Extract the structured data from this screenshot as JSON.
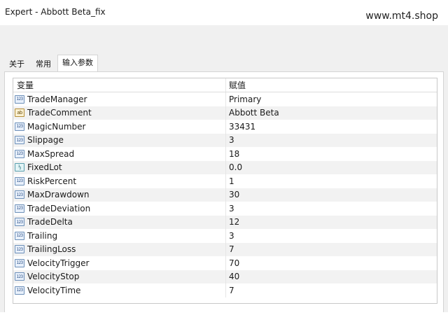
{
  "window": {
    "title": "Expert - Abbott Beta_fix"
  },
  "watermark": "www.mt4.shop",
  "tabs": [
    {
      "label": "关于"
    },
    {
      "label": "常用"
    },
    {
      "label": "输入参数"
    }
  ],
  "table": {
    "columns": {
      "name": "变量",
      "value": "赋值"
    },
    "rows": [
      {
        "name": "TradeManager",
        "value": "Primary",
        "icon": "123"
      },
      {
        "name": "TradeComment",
        "value": "Abbott Beta",
        "icon": "ab"
      },
      {
        "name": "MagicNumber",
        "value": "33431",
        "icon": "123"
      },
      {
        "name": "Slippage",
        "value": "3",
        "icon": "123"
      },
      {
        "name": "MaxSpread",
        "value": "18",
        "icon": "123"
      },
      {
        "name": "FixedLot",
        "value": "0.0",
        "icon": "½"
      },
      {
        "name": "RiskPercent",
        "value": "1",
        "icon": "123"
      },
      {
        "name": "MaxDrawdown",
        "value": "30",
        "icon": "123"
      },
      {
        "name": "TradeDeviation",
        "value": "3",
        "icon": "123"
      },
      {
        "name": "TradeDelta",
        "value": "12",
        "icon": "123"
      },
      {
        "name": "Trailing",
        "value": "3",
        "icon": "123"
      },
      {
        "name": "TrailingLoss",
        "value": "7",
        "icon": "123"
      },
      {
        "name": "VelocityTrigger",
        "value": "70",
        "icon": "123"
      },
      {
        "name": "VelocityStop",
        "value": "40",
        "icon": "123"
      },
      {
        "name": "VelocityTime",
        "value": "7",
        "icon": "123"
      }
    ]
  }
}
